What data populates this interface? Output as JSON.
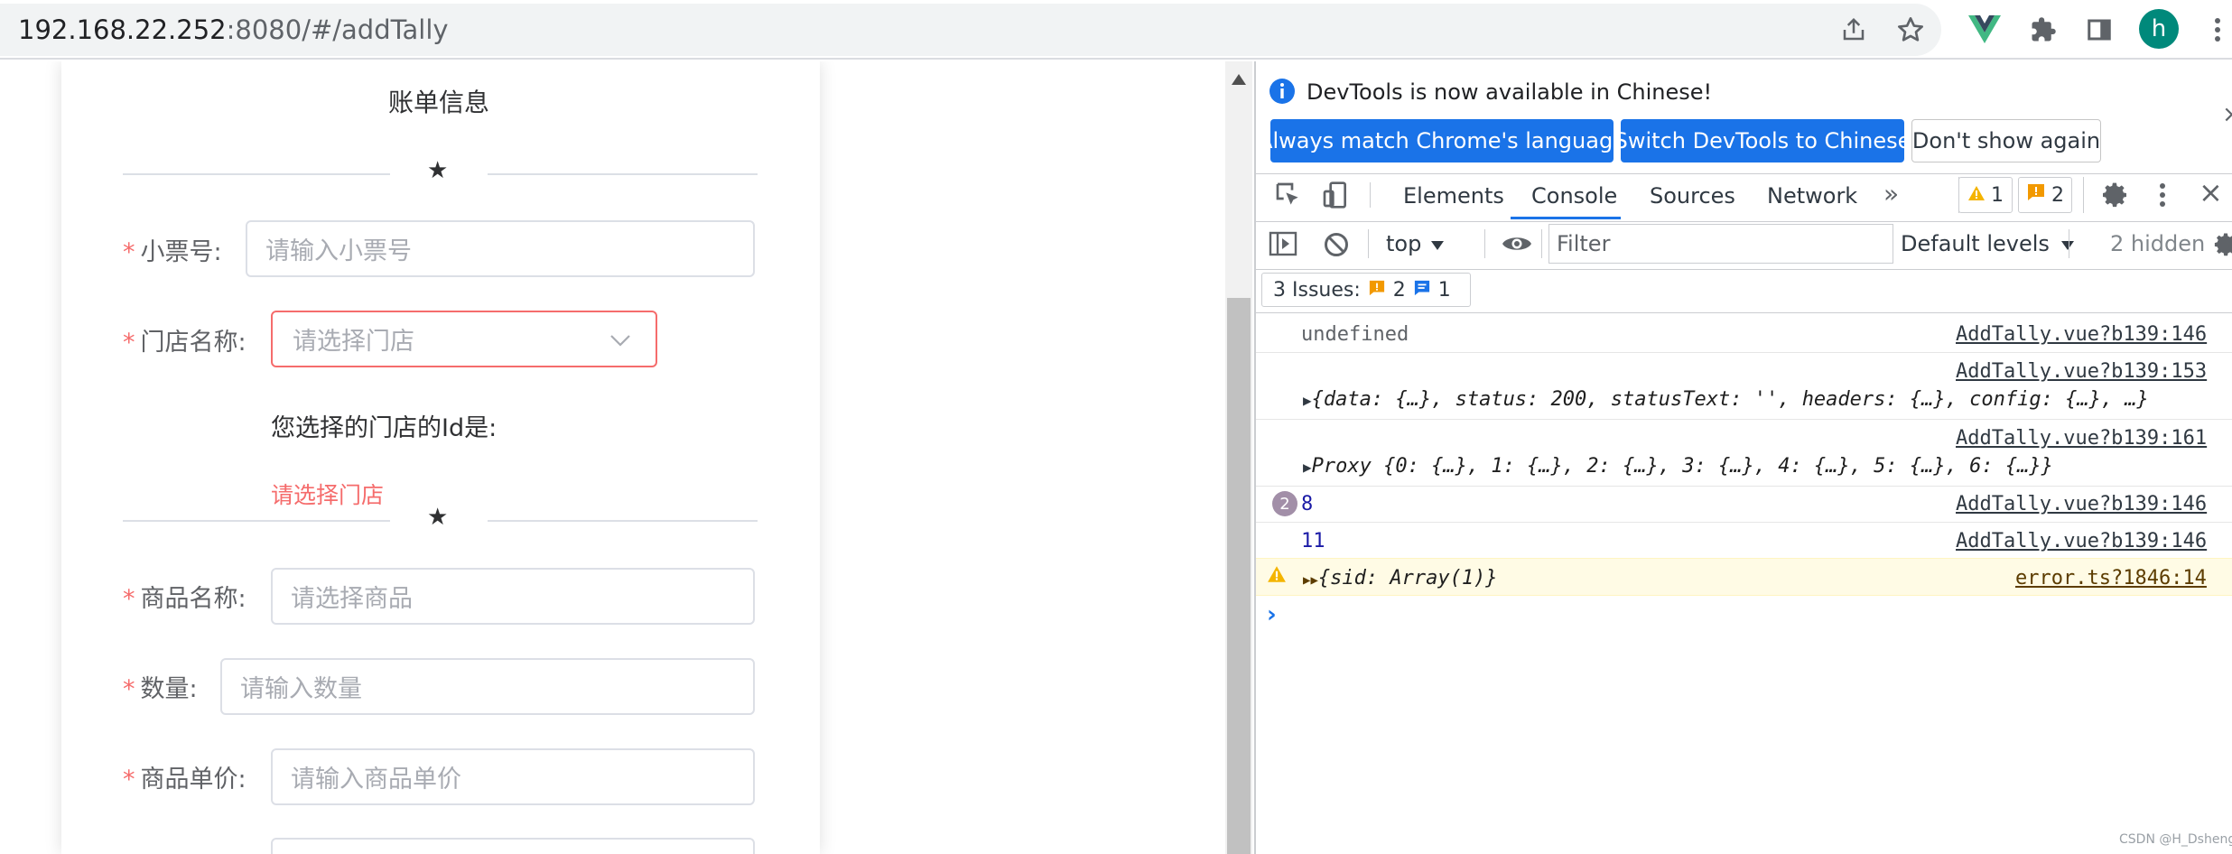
{
  "browser": {
    "url_host": "192.168.22.252",
    "url_rest": ":8080/#/addTally",
    "profile_initial": "h"
  },
  "form": {
    "title": "账单信息",
    "receipt_label": "小票号:",
    "receipt_placeholder": "请输入小票号",
    "store_label": "门店名称:",
    "store_placeholder": "请选择门店",
    "store_id_text": "您选择的门店的Id是:",
    "store_error": "请选择门店",
    "product_label": "商品名称:",
    "product_placeholder": "请选择商品",
    "quantity_label": "数量:",
    "quantity_placeholder": "请输入数量",
    "price_label": "商品单价:",
    "price_placeholder": "请输入商品单价",
    "required_mark": "*",
    "star": "★"
  },
  "devtools": {
    "banner_text": "DevTools is now available in Chinese!",
    "btn_match": "Always match Chrome's language",
    "btn_switch": "Switch DevTools to Chinese",
    "btn_dont_show": "Don't show again",
    "tabs": [
      "Elements",
      "Console",
      "Sources",
      "Network"
    ],
    "active_tab": "Console",
    "warn_count": "1",
    "issue_count": "2",
    "context": "top",
    "filter_placeholder": "Filter",
    "levels": "Default levels",
    "hidden": "2 hidden",
    "issues_label": "3 Issues:",
    "issues_warn": "2",
    "issues_info": "1",
    "console": [
      {
        "text": "undefined",
        "source": "AddTally.vue?b139:146"
      },
      {
        "source": "AddTally.vue?b139:153",
        "object": "{data: {…}, status: 200, statusText: '', headers: {…}, config: {…}, …}"
      },
      {
        "source": "AddTally.vue?b139:161",
        "object": "Proxy {0: {…}, 1: {…}, 2: {…}, 3: {…}, 4: {…}, 5: {…}, 6: {…}}"
      },
      {
        "repeat": "2",
        "text": "8",
        "source": "AddTally.vue?b139:146"
      },
      {
        "text": "11",
        "source": "AddTally.vue?b139:146"
      },
      {
        "object": "{sid: Array(1)}",
        "source": "error.ts?1846:14",
        "level": "warning"
      }
    ],
    "prompt": "›"
  },
  "watermark": "CSDN @H_Dsheng",
  "colors": {
    "accent": "#1a73e8",
    "error": "#f56c6c",
    "warning_bg": "#fffbe5"
  }
}
